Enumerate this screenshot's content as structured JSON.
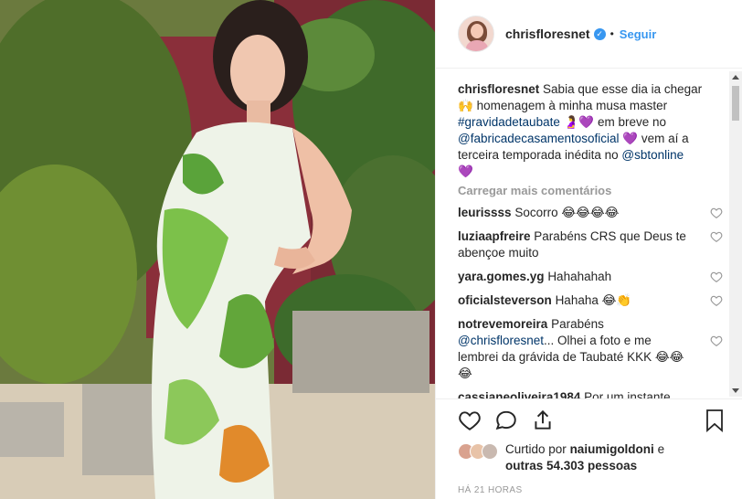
{
  "post": {
    "photo_icon": "maternity-photo",
    "author": {
      "username": "chrisfloresnet",
      "verified_icon": "verified-badge-icon",
      "dot": "•",
      "follow_label": "Seguir"
    }
  },
  "caption": {
    "username": "chrisfloresnet",
    "text_1": "Sabia que esse dia ia chegar",
    "emoji_1": "🙌",
    "text_2": "homenagem à minha musa master",
    "hashtag": "#gravidadetaubate",
    "emoji_2": "🤰💜",
    "text_3": "em breve no",
    "mention_1": "@fabricadecasamentosoficial",
    "emoji_3": "💜",
    "text_4": "vem aí a terceira temporada inédita no",
    "mention_2": "@sbtonline",
    "emoji_4": "💜"
  },
  "load_more_label": "Carregar mais comentários",
  "comments": [
    {
      "user": "leurissss",
      "text": "Socorro",
      "emoji": "😂😂😂😂"
    },
    {
      "user": "luziaapfreire",
      "text": "Parabéns CRS que Deus te abençoe muito",
      "emoji": ""
    },
    {
      "user": "yara.gomes.yg",
      "text": "Hahahahah",
      "emoji": ""
    },
    {
      "user": "oficialsteverson",
      "text": "Hahaha",
      "emoji": "😂👏"
    },
    {
      "user": "notrevemoreira",
      "text_a": "Parabéns",
      "mention": "@chrisfloresnet",
      "text_b": "... Olhei a foto e me lembrei da grávida de Taubaté KKK",
      "emoji": "😂😂😂"
    },
    {
      "user": "cassianeoliveira1984",
      "text": "Por um instante",
      "emoji": ""
    }
  ],
  "likes": {
    "prefix": "Curtido por",
    "user": "naiumigoldoni",
    "and": "e",
    "others": "outras 54.303 pessoas"
  },
  "timestamp": "HÁ 21 HORAS",
  "colors": {
    "accent": "#3897f0",
    "link": "#003569",
    "muted": "#999999"
  }
}
